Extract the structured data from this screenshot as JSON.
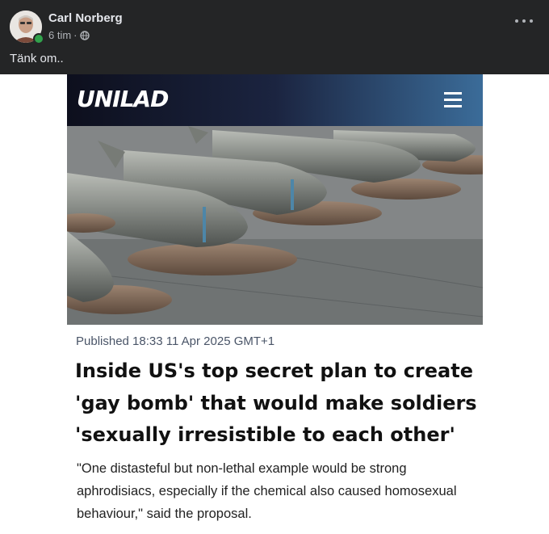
{
  "post": {
    "author": "Carl Norberg",
    "time": "6 tim",
    "separator": "·",
    "text": "Tänk om.."
  },
  "icons": {
    "avatar": "avatar-photo",
    "privacy": "globe-icon",
    "more": "more-horizontal-icon",
    "menu": "hamburger-menu-icon"
  },
  "article": {
    "site": "UNILAD",
    "published": "Published 18:33 11 Apr 2025 GMT+1",
    "headline": "Inside US's top secret plan to create 'gay bomb' that would make soldiers 'sexually irresistible to each other'",
    "summary": "\"One distasteful but non-lethal example would be strong aphrodisiacs, especially if the chemical also caused homosexual behaviour,\" said the proposal."
  },
  "colors": {
    "header_bg": "#242526",
    "online": "#31a24c",
    "text_light": "#e4e6eb",
    "text_muted": "#b0b3b8"
  }
}
